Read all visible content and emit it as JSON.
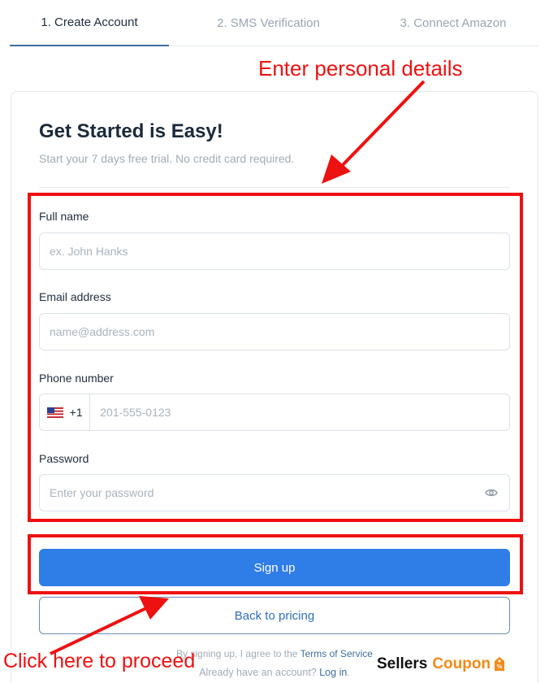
{
  "steps": [
    {
      "label": "1. Create Account"
    },
    {
      "label": "2. SMS Verification"
    },
    {
      "label": "3. Connect Amazon"
    }
  ],
  "form": {
    "title": "Get Started is Easy!",
    "subtitle": "Start your 7 days free trial. No credit card required.",
    "full_name": {
      "label": "Full name",
      "placeholder": "ex. John Hanks"
    },
    "email": {
      "label": "Email address",
      "placeholder": "name@address.com"
    },
    "phone": {
      "label": "Phone number",
      "country_code": "+1",
      "placeholder": "201-555-0123",
      "flag_icon": "us-flag-icon"
    },
    "password": {
      "label": "Password",
      "placeholder": "Enter your password",
      "toggle_icon": "eye-icon"
    },
    "signup_label": "Sign up",
    "back_label": "Back to pricing",
    "terms_prefix": "By signing up, I agree to the",
    "terms_link": "Terms of Service",
    "login_prefix": "Already have an account?",
    "login_link": "Log in",
    "login_suffix": "."
  },
  "annotations": {
    "top_text": "Enter personal details",
    "bottom_text": "Click here to proceed",
    "color": "#ee1111"
  },
  "watermark": {
    "part1": "Sellers",
    "part2": "Coupon"
  },
  "colors": {
    "primary": "#2f7de6",
    "active_step_underline": "#3d6e9b"
  }
}
